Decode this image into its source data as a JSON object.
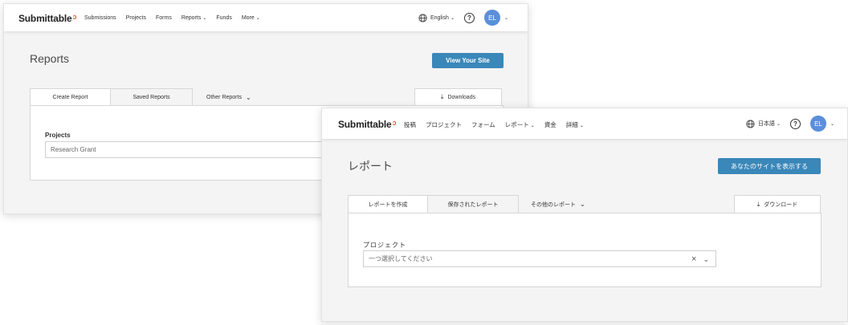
{
  "en": {
    "logo": "Submittable",
    "nav": [
      "Submissions",
      "Projects",
      "Forms",
      "Reports",
      "Funds",
      "More"
    ],
    "language": "English",
    "help": "?",
    "avatar": "EL",
    "title": "Reports",
    "view_site": "View Your Site",
    "tabs": {
      "create": "Create Report",
      "saved": "Saved Reports",
      "other": "Other Reports"
    },
    "downloads": "Downloads",
    "field_label": "Projects",
    "field_value": "Research Grant"
  },
  "ja": {
    "logo": "Submittable",
    "nav": [
      "投稿",
      "プロジェクト",
      "フォーム",
      "レポート",
      "資金",
      "詳細"
    ],
    "language": "日本語",
    "help": "?",
    "avatar": "EL",
    "title": "レポート",
    "view_site": "あなたのサイトを表示する",
    "tabs": {
      "create": "レポートを作成",
      "saved": "保存されたレポート",
      "other": "その他のレポート"
    },
    "downloads": "ダウンロード",
    "field_label": "プロジェクト",
    "field_placeholder": "一つ選択してください"
  },
  "icons": [
    "globe-icon",
    "help-icon",
    "chevron-down-icon",
    "download-icon",
    "clear-icon"
  ],
  "colors": {
    "primary": "#3a87b9",
    "avatar": "#5b8fd9",
    "logo_mark": "#e8573f"
  }
}
